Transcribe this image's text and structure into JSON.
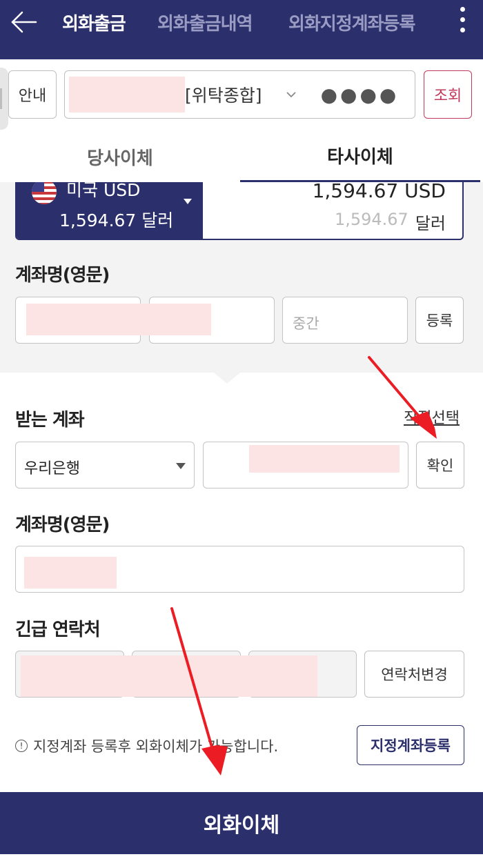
{
  "nav": {
    "tabs": [
      {
        "label": "외화출금",
        "active": true
      },
      {
        "label": "외화출금내역",
        "active": false
      },
      {
        "label": "외화지정계좌등록",
        "active": false
      }
    ]
  },
  "account": {
    "info_label": "안내",
    "account_type": "[위탁종합]",
    "password_mask": "●●●●",
    "query_label": "조회"
  },
  "transfer_tabs": [
    {
      "label": "당사이체",
      "active": false
    },
    {
      "label": "타사이체",
      "active": true
    }
  ],
  "currency": {
    "name": "미국 USD",
    "amount_local": "1,594.67 달러",
    "balance_usd": "1,594.67 USD",
    "balance_local_num": "1,594.67",
    "balance_local_unit": "달러"
  },
  "sender": {
    "name_label": "계좌명(영문)",
    "middle_placeholder": "중간",
    "register_label": "등록"
  },
  "receiver": {
    "title": "받는 계좌",
    "direct_select": "직접선택",
    "bank": "우리은행",
    "confirm_label": "확인",
    "name_label": "계좌명(영문)"
  },
  "emergency": {
    "title": "긴급 연락처",
    "change_label": "연락처변경"
  },
  "notice": {
    "text": "지정계좌 등록후 외화이체가 가능합니다.",
    "register_button": "지정계좌등록"
  },
  "submit_label": "외화이체",
  "colors": {
    "primary": "#2b2f6b",
    "accent_red": "#c0395a",
    "redaction": "#fde4e4"
  }
}
